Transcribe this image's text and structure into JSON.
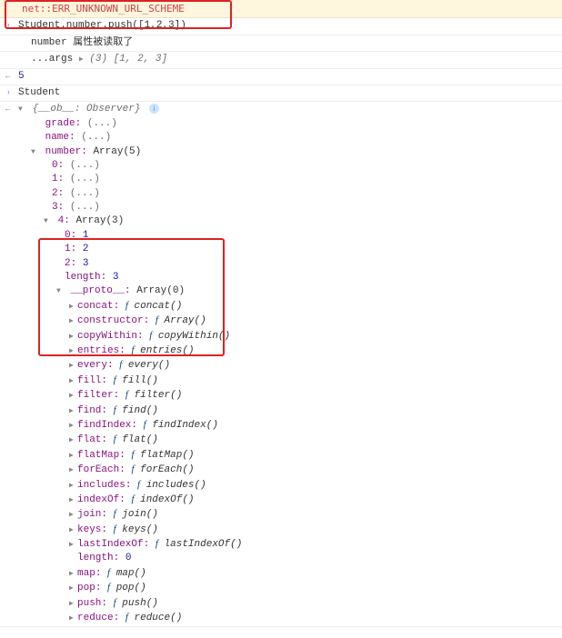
{
  "error": "net::ERR_UNKNOWN_URL_SCHEME",
  "input_line": "Student.number.push([1,2,3])",
  "log1_label": "number",
  "log1_text": "属性被读取了",
  "log2_prefix": "...args",
  "log2_arrow": "▶",
  "log2_count": "(3)",
  "log2_array": "[1, 2, 3]",
  "return_val": "5",
  "return_obj": "Student",
  "observer_label": "{__ob__: Observer}",
  "props": {
    "grade": "grade",
    "name": "name",
    "number": "number",
    "number_type": "Array(5)",
    "idx0": "0",
    "idx1": "1",
    "idx2": "2",
    "idx3": "3",
    "idx4": "4",
    "idx4_type": "Array(3)",
    "idx4_0_k": "0",
    "idx4_0_v": "1",
    "idx4_1_k": "1",
    "idx4_1_v": "2",
    "idx4_2_k": "2",
    "idx4_2_v": "3",
    "idx4_len_k": "length",
    "idx4_len_v": "3",
    "proto": "__proto__",
    "proto_type": "Array(0)",
    "ellipsis": "(...)",
    "length0": "0"
  },
  "protos": [
    {
      "k": "concat",
      "v": "concat()"
    },
    {
      "k": "constructor",
      "v": "Array()"
    },
    {
      "k": "copyWithin",
      "v": "copyWithin()"
    },
    {
      "k": "entries",
      "v": "entries()"
    },
    {
      "k": "every",
      "v": "every()"
    },
    {
      "k": "fill",
      "v": "fill()"
    },
    {
      "k": "filter",
      "v": "filter()"
    },
    {
      "k": "find",
      "v": "find()"
    },
    {
      "k": "findIndex",
      "v": "findIndex()"
    },
    {
      "k": "flat",
      "v": "flat()"
    },
    {
      "k": "flatMap",
      "v": "flatMap()"
    },
    {
      "k": "forEach",
      "v": "forEach()"
    },
    {
      "k": "includes",
      "v": "includes()"
    },
    {
      "k": "indexOf",
      "v": "indexOf()"
    },
    {
      "k": "join",
      "v": "join()"
    },
    {
      "k": "keys",
      "v": "keys()"
    },
    {
      "k": "lastIndexOf",
      "v": "lastIndexOf()"
    }
  ],
  "protos2": [
    {
      "k": "map",
      "v": "map()"
    },
    {
      "k": "pop",
      "v": "pop()"
    },
    {
      "k": "push",
      "v": "push()"
    },
    {
      "k": "reduce",
      "v": "reduce()"
    }
  ]
}
